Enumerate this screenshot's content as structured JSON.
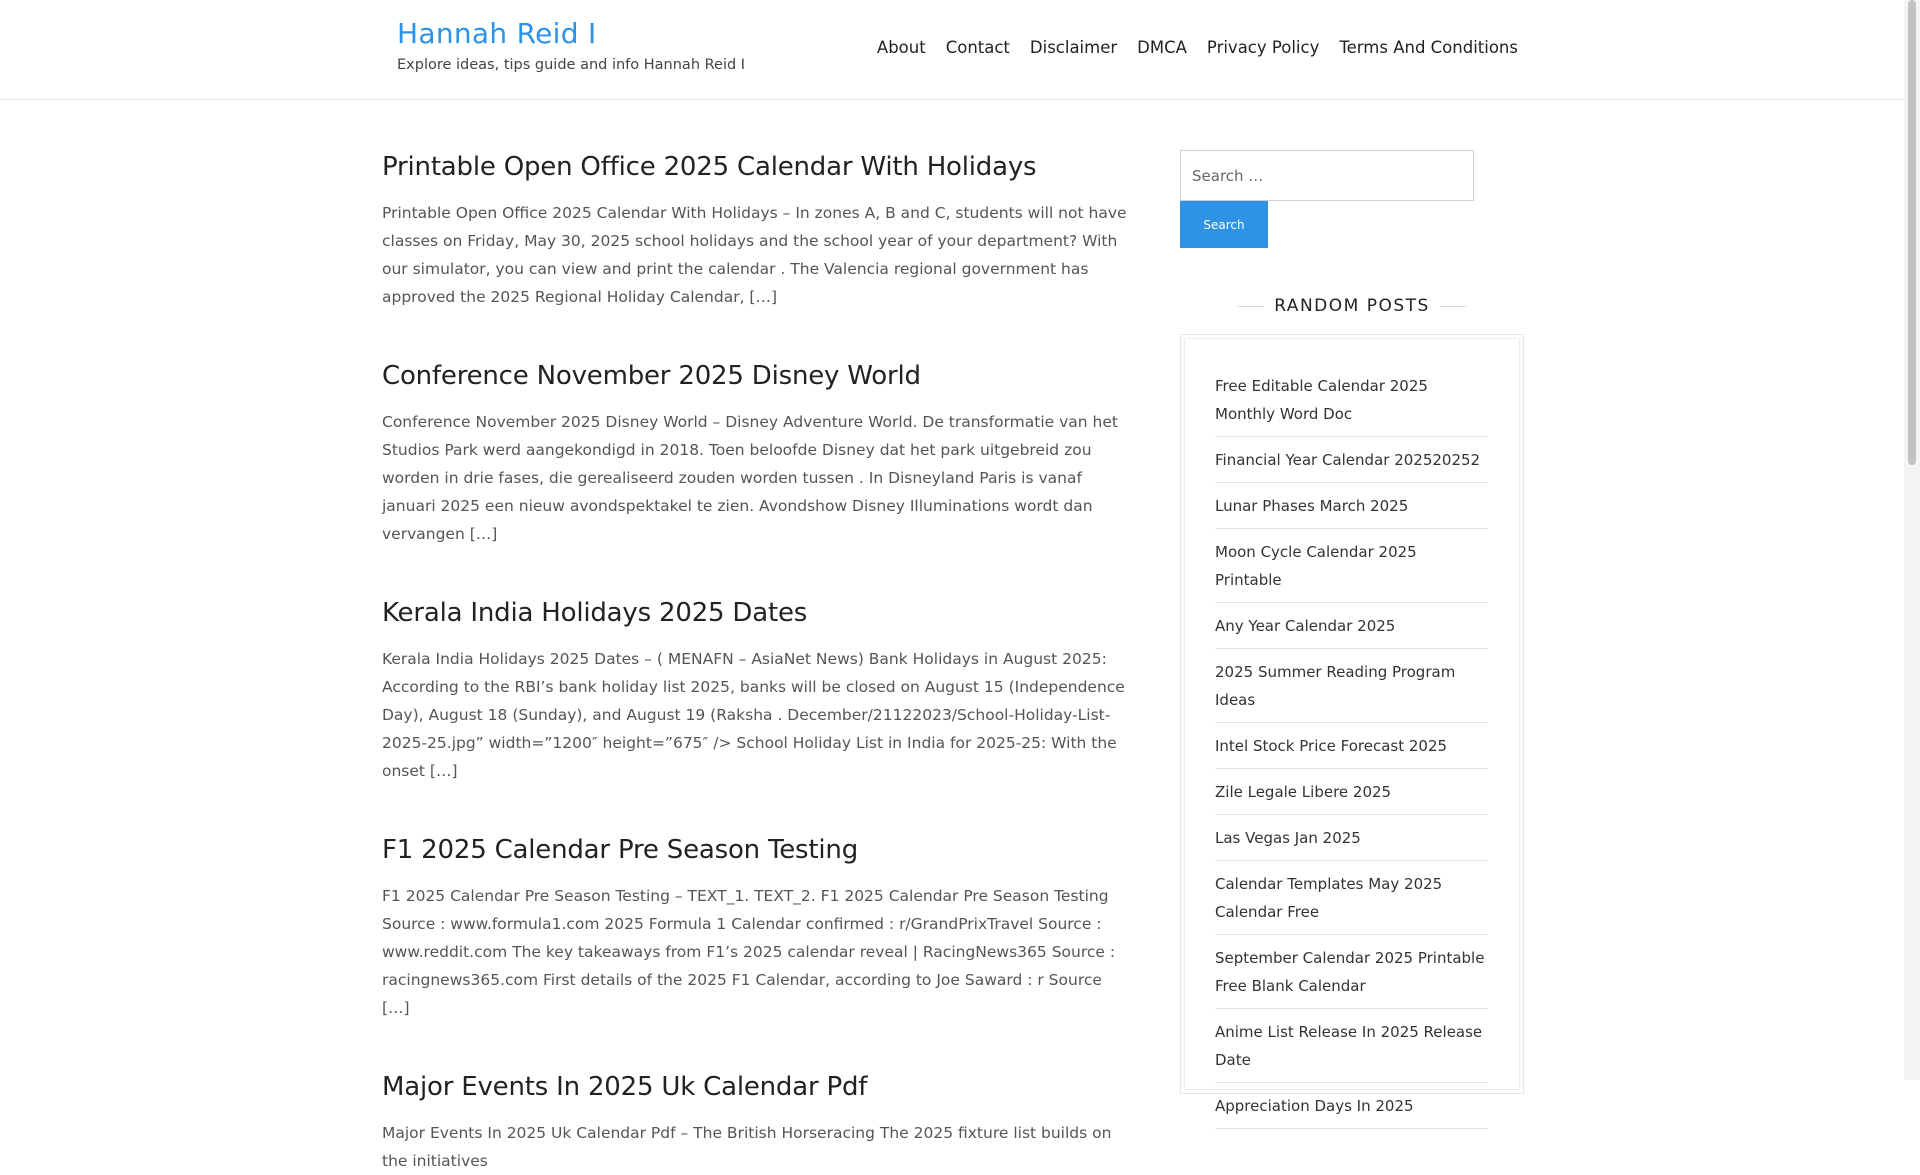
{
  "header": {
    "site_title": "Hannah Reid I",
    "site_description": "Explore ideas, tips guide and info Hannah Reid I",
    "nav": [
      "About",
      "Contact",
      "Disclaimer",
      "DMCA",
      "Privacy Policy",
      "Terms And Conditions"
    ]
  },
  "posts": [
    {
      "title": "Printable Open Office 2025 Calendar With Holidays",
      "excerpt": "Printable Open Office 2025 Calendar With Holidays – In zones A, B and C, students will not have classes on Friday, May 30, 2025 school holidays and the school year of your department? With our simulator, you can view and print the calendar . The Valencia regional government has approved the 2025 Regional Holiday Calendar, […]"
    },
    {
      "title": "Conference November 2025 Disney World",
      "excerpt": "Conference November 2025 Disney World – Disney Adventure World. De transformatie van het Studios Park werd aangekondigd in 2018. Toen beloofde Disney dat het park uitgebreid zou worden in drie fases, die gerealiseerd zouden worden tussen . In Disneyland Paris is vanaf januari 2025 een nieuw avondspektakel te zien. Avondshow Disney Illuminations wordt dan vervangen […]"
    },
    {
      "title": "Kerala India Holidays 2025 Dates",
      "excerpt": "Kerala India Holidays 2025 Dates – ( MENAFN – AsiaNet News) Bank Holidays in August 2025: According to the RBI’s bank holiday list 2025, banks will be closed on August 15 (Independence Day), August 18 (Sunday), and August 19 (Raksha . December/21122023/School-Holiday-List-2025-25.jpg” width=”1200″ height=”675″ /> School Holiday List in India for 2025-25: With the onset […]"
    },
    {
      "title": "F1 2025 Calendar Pre Season Testing",
      "excerpt": "F1 2025 Calendar Pre Season Testing – TEXT_1. TEXT_2. F1 2025 Calendar Pre Season Testing Source : www.formula1.com 2025 Formula 1 Calendar confirmed : r/GrandPrixTravel Source : www.reddit.com The key takeaways from F1’s 2025 calendar reveal | RacingNews365 Source : racingnews365.com First details of the 2025 F1 Calendar, according to Joe Saward : r Source […]"
    },
    {
      "title": "Major Events In 2025 Uk Calendar Pdf",
      "excerpt": "Major Events In 2025 Uk Calendar Pdf – The British Horseracing The 2025 fixture list builds on the initiatives"
    }
  ],
  "sidebar": {
    "search_placeholder": "Search …",
    "search_button": "Search",
    "widget_title": "RANDOM POSTS",
    "random_posts": [
      "Free Editable Calendar 2025 Monthly Word Doc",
      "Financial Year Calendar 202520252",
      "Lunar Phases March 2025",
      "Moon Cycle Calendar 2025 Printable",
      "Any Year Calendar 2025",
      "2025 Summer Reading Program Ideas",
      "Intel Stock Price Forecast 2025",
      "Zile Legale Libere 2025",
      "Las Vegas Jan 2025",
      "Calendar Templates May 2025 Calendar Free",
      "September Calendar 2025 Printable Free Blank Calendar",
      "Anime List Release In 2025 Release Date",
      "Appreciation Days In 2025"
    ]
  },
  "colors": {
    "accent": "#2e93e6",
    "text": "#333333",
    "border": "#e6e6e6"
  }
}
